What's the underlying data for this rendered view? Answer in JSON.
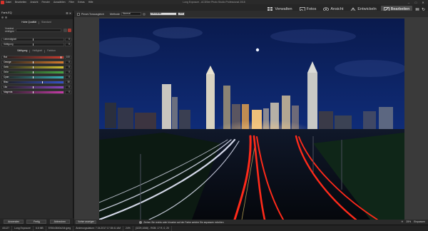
{
  "window": {
    "title": "Long Exposure - ACDSee Photo Studio Professional 2018",
    "menu": [
      "Datei",
      "Bearbeiten",
      "Ansicht",
      "Fenster",
      "Auswählen",
      "Filter",
      "Extras",
      "Hilfe"
    ]
  },
  "mode_tabs": [
    {
      "label": "Verwalten",
      "active": false,
      "icon": "grid-icon"
    },
    {
      "label": "Fotos",
      "active": false,
      "icon": "photos-icon"
    },
    {
      "label": "Ansicht",
      "active": false,
      "icon": "eye-icon"
    },
    {
      "label": "Entwickeln",
      "active": false,
      "icon": "develop-icon"
    },
    {
      "label": "Bearbeiten",
      "active": true,
      "icon": "edit-icon"
    }
  ],
  "panel": {
    "title": "Farb-EQ",
    "quality_tabs": [
      "Hohe Qualität",
      "Standard"
    ],
    "preset_label": "Voreinstellungen",
    "presets_line1": "Voreinst.",
    "presets_line2": "einfügen",
    "sliders_top": [
      {
        "label": "Lebendigkeit",
        "value": "0"
      },
      {
        "label": "Sättigung",
        "value": "0"
      }
    ],
    "sub_tabs": [
      "Sättigung",
      "Helligkeit",
      "Farbton"
    ],
    "color_sliders": [
      {
        "label": "Rot",
        "value": "100",
        "color": "#c83a2c",
        "mark": 0.95
      },
      {
        "label": "Orange",
        "value": "0",
        "color": "#d67a2a",
        "mark": 0.5
      },
      {
        "label": "Gelb",
        "value": "0",
        "color": "#cfc12d",
        "mark": 0.5
      },
      {
        "label": "Grün",
        "value": "0",
        "color": "#46a640",
        "mark": 0.5
      },
      {
        "label": "Cyan",
        "value": "0",
        "color": "#35b0b8",
        "mark": 0.5
      },
      {
        "label": "Blau",
        "value": "30",
        "color": "#3451c8",
        "mark": 0.65
      },
      {
        "label": "Lila",
        "value": "0",
        "color": "#8b44c2",
        "mark": 0.5
      },
      {
        "label": "Magenta",
        "value": "0",
        "color": "#c63aa8",
        "mark": 0.5
      }
    ],
    "footer": [
      "Anwenden",
      "Fertig",
      "Abbrechen"
    ]
  },
  "toolbar": {
    "split_label": "Pinsel-Tonausgleich",
    "mode_label": "Methode",
    "mode_value": "Normal",
    "param_value": "Deckkraft",
    "param_num": "100"
  },
  "bottom": {
    "compare": "Vorher anzeigen",
    "hint": "Ziehen Sie rechts oder hinunter auf der Farbe welche Sie anpassen möchten",
    "zoom": "25%",
    "zoom_label": "Einpassen"
  },
  "status": [
    "4/1127",
    "Long Exposure",
    "6.6 MB",
    "5760x3840x24b.jpeg",
    "Änderungsdatum: 7.04.2017 17:35:41 AM",
    "24%",
    "(3229,1068) - RGB: 17 R, 0, 20"
  ],
  "colors": {
    "accent": "#4b4b4b",
    "panel_bg": "#2b2b2b",
    "sky_top": "#0b1b4a",
    "trail_red": "#ff2a1a",
    "trail_white": "#f2f4ff"
  }
}
